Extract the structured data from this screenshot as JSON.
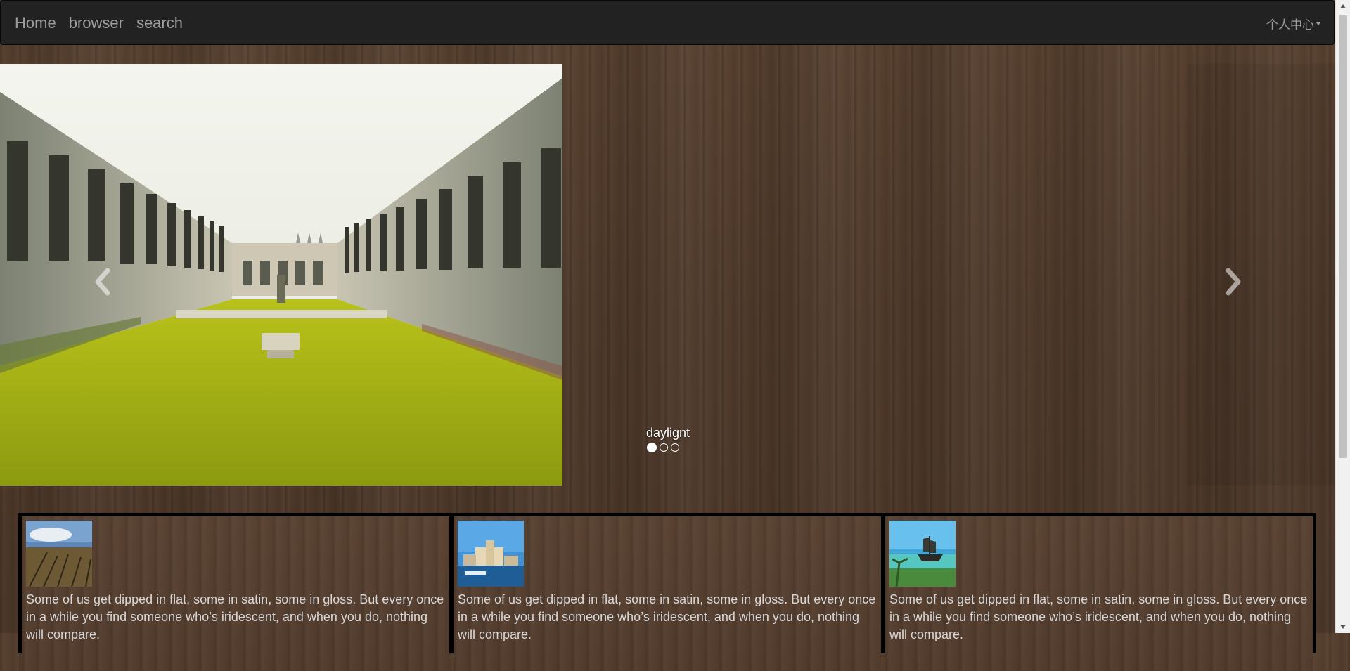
{
  "navbar": {
    "links": [
      "Home",
      "browser",
      "search"
    ],
    "user_menu": "个人中心"
  },
  "carousel": {
    "caption": "daylignt",
    "slide_count": 3,
    "active_index": 0,
    "prev_icon": "chevron-left-icon",
    "next_icon": "chevron-right-icon"
  },
  "cards": [
    {
      "thumb": "field-photo",
      "text": "Some of us get dipped in flat, some in satin, some in gloss. But every once in a while you find someone who’s iridescent, and when you do, nothing will compare."
    },
    {
      "thumb": "harbor-city-photo",
      "text": "Some of us get dipped in flat, some in satin, some in gloss. But every once in a while you find someone who’s iridescent, and when you do, nothing will compare."
    },
    {
      "thumb": "pirate-ship-photo",
      "text": "Some of us get dipped in flat, some in satin, some in gloss. But every once in a while you find someone who’s iridescent, and when you do, nothing will compare."
    }
  ],
  "colors": {
    "navbar_bg": "#222222",
    "nav_text": "#9d9d9d",
    "card_border": "#000000",
    "card_text": "#d7d7d7"
  }
}
